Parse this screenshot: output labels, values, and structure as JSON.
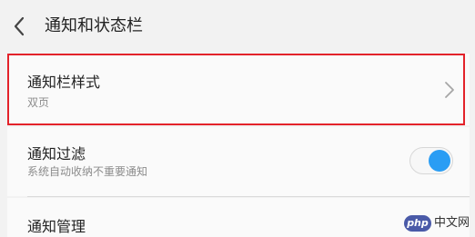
{
  "header": {
    "back_icon": "chevron-left-icon",
    "title": "通知和状态栏"
  },
  "settings": [
    {
      "title": "通知栏样式",
      "subtitle": "双页",
      "control": "chevron-right-icon",
      "highlighted": true
    },
    {
      "title": "通知过滤",
      "subtitle": "系统自动收纳不重要通知",
      "control": "toggle",
      "toggle_on": true
    },
    {
      "title": "通知管理"
    }
  ],
  "watermark": {
    "logo": "php",
    "text": "中文网"
  },
  "colors": {
    "highlight_border": "#e3222a",
    "toggle_knob": "#2a9df4",
    "background": "#f2f2f2"
  }
}
